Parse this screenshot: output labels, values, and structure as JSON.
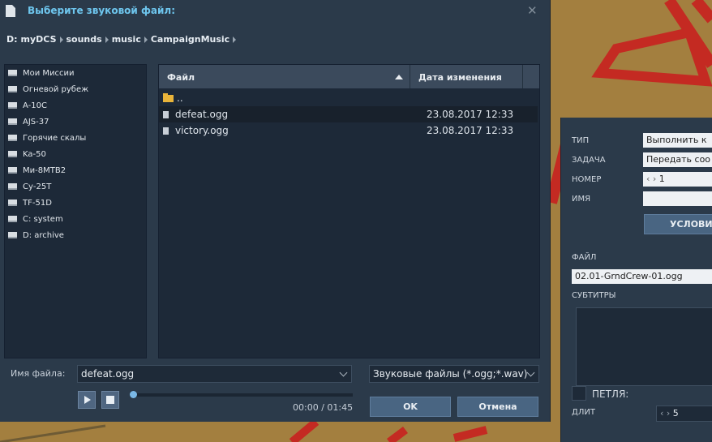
{
  "dialog": {
    "title": "Выберите звуковой файл:",
    "breadcrumb": [
      "D:",
      "myDCS",
      "sounds",
      "music",
      "CampaignMusic"
    ],
    "sidebar": [
      "Мои Миссии",
      "Огневой рубеж",
      "A-10C",
      "AJS-37",
      "Горячие скалы",
      "Ka-50",
      "Ми-8МТВ2",
      "Су-25Т",
      "TF-51D",
      "C: system",
      "D: archive"
    ],
    "columns": {
      "name": "Файл",
      "date": "Дата изменения"
    },
    "parent_dir": "..",
    "files": [
      {
        "name": "defeat.ogg",
        "date": "23.08.2017 12:33",
        "selected": true
      },
      {
        "name": "victory.ogg",
        "date": "23.08.2017 12:33",
        "selected": false
      }
    ],
    "filename_label": "Имя файла:",
    "filename_value": "defeat.ogg",
    "filter_value": "Звуковые файлы (*.ogg;*.wav)",
    "time": "00:00 / 01:45",
    "playback_progress": 0,
    "ok_label": "OK",
    "cancel_label": "Отмена"
  },
  "props": {
    "type_label": "ТИП",
    "type_value": "Выполнить к",
    "task_label": "ЗАДАЧА",
    "task_value": "Передать соо",
    "number_label": "НОМЕР",
    "number_value": "1",
    "name_label": "ИМЯ",
    "name_value": "",
    "conditions_label": "УСЛОВИ",
    "file_label": "ФАЙЛ",
    "file_value": "02.01-GrndCrew-01.ogg",
    "subtitles_label": "СУБТИТРЫ",
    "loop_label": "ПЕТЛЯ:",
    "duration_label": "ДЛИТ",
    "duration_value": "5"
  },
  "colors": {
    "dialog_bg": "#2b3a4a",
    "accent_title": "#6ec6ee",
    "map_ground": "#a37f3f",
    "map_line": "#c42a22"
  }
}
